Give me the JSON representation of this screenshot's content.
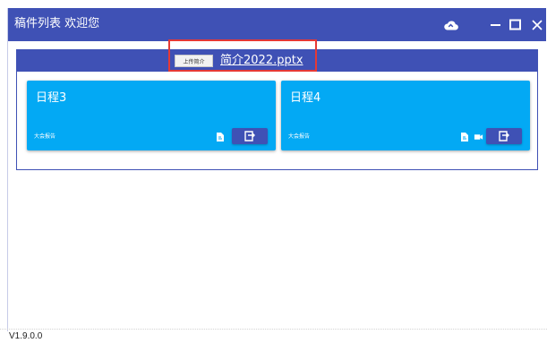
{
  "app": {
    "title": "稿件列表 欢迎您",
    "version": "V1.9.0.0"
  },
  "titlebar": {
    "icons": [
      "cloud-icon",
      "minimize-icon",
      "maximize-icon",
      "close-icon"
    ]
  },
  "panel": {
    "upload_label": "上传简介",
    "file_name": "简介2022.pptx",
    "highlight_color": "#e53935"
  },
  "cards": [
    {
      "title": "日程3",
      "subtitle": "大会报告",
      "icons": [
        "file-icon"
      ],
      "action_icon": "export-icon"
    },
    {
      "title": "日程4",
      "subtitle": "大会报告",
      "icons": [
        "file-icon",
        "video-icon"
      ],
      "action_icon": "export-icon"
    }
  ],
  "colors": {
    "primary": "#3f51b5",
    "card": "#03a9f4",
    "text_light": "#ffffff"
  }
}
